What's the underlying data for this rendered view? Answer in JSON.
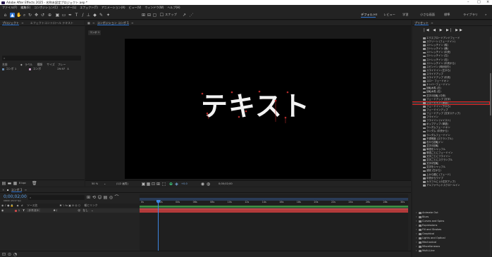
{
  "window": {
    "title": "Adobe After Effects 2025 - 名称未設定プロジェクト.aep *"
  },
  "menu": [
    "ファイル(F)",
    "編集(E)",
    "コンポジション(C)",
    "レイヤー(L)",
    "エフェクト(T)",
    "アニメーション(A)",
    "ビュー(V)",
    "ウィンドウ(W)",
    "ヘルプ(H)"
  ],
  "toolbar": {
    "snap_label": "スナップ"
  },
  "workspaces": [
    "デフォルト",
    "レビュー",
    "学習",
    "小さな画面",
    "標準",
    "ライブラリ"
  ],
  "project_panel": {
    "tab_project": "プロジェクト",
    "tab_effect_controls": "エフェクトコントロール テキスト",
    "search_placeholder": "ρ̲",
    "columns": [
      "名前",
      "ラベル",
      "種類",
      "サイズ",
      "フレー"
    ],
    "items": [
      {
        "name": "コンポ 1",
        "type": "コンポ",
        "fps": "29.97"
      }
    ],
    "bpc": "8 bpc"
  },
  "composition_panel": {
    "tab_label": "コンポジション コンポ 1",
    "comp_tab": "コンポ 1",
    "text": "テキスト",
    "zoom": "50 %",
    "quality": "(1/2 画質)",
    "timecode": "0;00;02;00",
    "exposure": "+0.0"
  },
  "timeline": {
    "tab_label": "コンポ 1",
    "timecode": "0;00;02;00",
    "fps_text": "00060 (29.97 fps)",
    "search_placeholder": "ρ̲",
    "col_source": "ソース名",
    "col_parent": "親とリンク",
    "layer_number": "1",
    "layer_name": "テキスト",
    "parent_value": "なし",
    "ticks": [
      "0s",
      "02s",
      "04s",
      "06s",
      "08s",
      "10s",
      "12s",
      "14s",
      "16s",
      "18s",
      "20s",
      "22s",
      "24s",
      "26s",
      "28s",
      "30s"
    ]
  },
  "presets_panel": {
    "title": "プリセット",
    "playback": [
      "|◀",
      "◀",
      "▶",
      "▶|",
      "▶▶"
    ],
    "items": [
      "エクスプロードアンドフェード",
      "スクリーン (フェードイン)",
      "ストレッチイン (縦)",
      "ストレッチイン (横)",
      "ストレッチイン (中央)",
      "ストレッチイン (左)",
      "ストレッチイン (右)",
      "ストレッチイン (中央から)",
      "スピンイン (時計回り)",
      "スライドイン (左から)",
      "スライドアップ",
      "スライドアップ (中央)",
      "スロー フェードオン",
      "ナンバーフェードイン",
      "回転木馬 (左)",
      "回転木馬 (右)",
      "文字の回転 (中央)",
      "フェードアップ (文字)",
      "フェードイン (単語)",
      "フェードイン (下から)",
      "フェードインアップ",
      "フェードアップ (文字ステップ)",
      "フライイン",
      "フライイン (ツイスト)",
      "ポップアップ (単語)",
      "ランダムフェードオン",
      "ランダム (中央から)",
      "ランダムフェードイン",
      "不透明度 (スクランブル)",
      "右から回転イン",
      "文字の回転",
      "単語をシャッフル",
      "単語ごとにフェードイン",
      "文字ごとにフライイン",
      "文字ごとにスクランブル",
      "文字が回転",
      "文字をシャッフル",
      "波紋 (左から)",
      "上から順に (フェード)",
      "中央からワイプ",
      "カラフルに (小文字アップ)",
      "アルファベットスクロールイン"
    ],
    "selected_index": 18,
    "folders": [
      "Animate Out",
      "Blurs",
      "Curves and Spins",
      "Expressions",
      "Fill and Strokes",
      "Graphical",
      "Lights and Optical",
      "Mechanical",
      "Miscellaneous",
      "Multi-Line"
    ]
  },
  "colors": {
    "accent": "#2f74d0",
    "highlight_box": "#e02020",
    "layer_bar": "#b23a3a",
    "work_area": "#3d8a43"
  }
}
